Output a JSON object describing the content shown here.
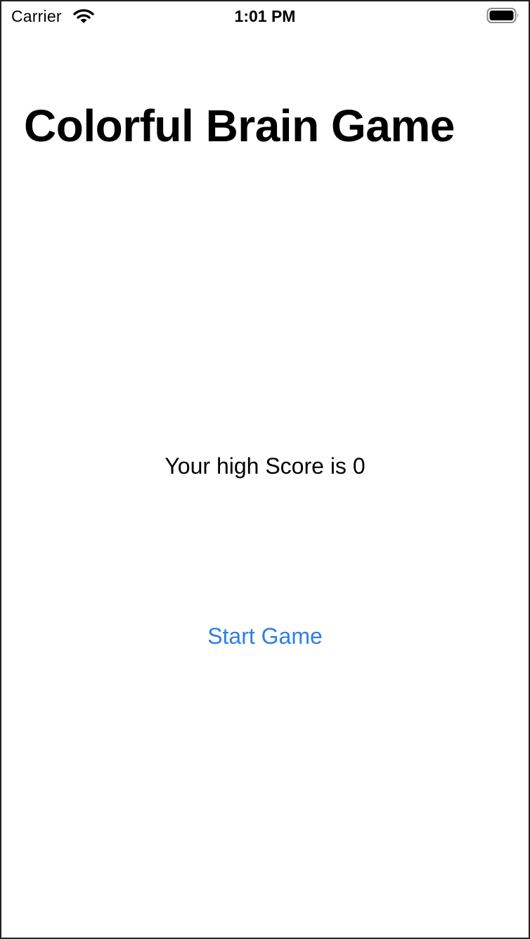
{
  "status_bar": {
    "carrier": "Carrier",
    "time": "1:01 PM",
    "wifi_icon": "wifi-icon",
    "battery_icon": "battery-full-icon"
  },
  "main": {
    "title": "Colorful Brain Game",
    "high_score_text": "Your high Score is 0",
    "start_button_label": "Start Game"
  },
  "colors": {
    "background": "#ffffff",
    "text": "#000000",
    "accent": "#2f7fe0"
  }
}
